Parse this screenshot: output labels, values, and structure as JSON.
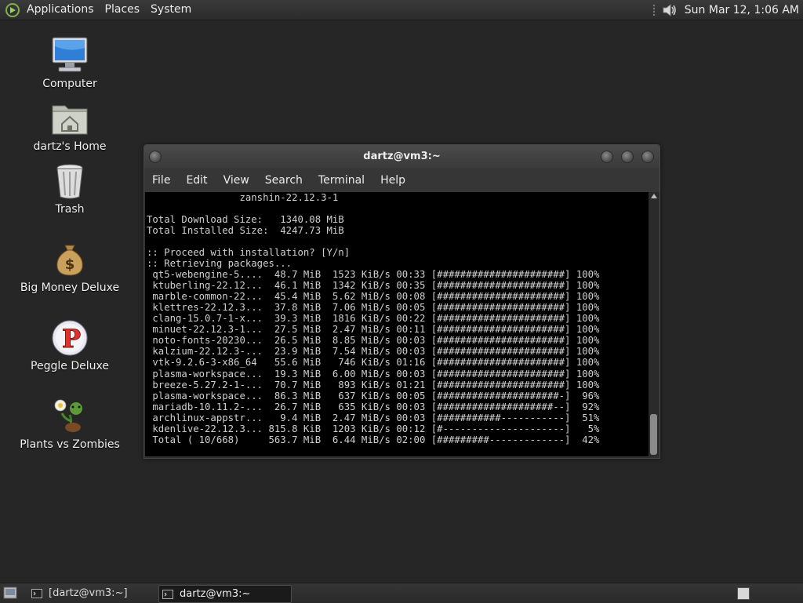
{
  "top_panel": {
    "menus": [
      "Applications",
      "Places",
      "System"
    ],
    "clock": "Sun Mar 12, 1:06 AM"
  },
  "desktop_icons": [
    {
      "name": "computer",
      "label": "Computer",
      "icon": "computer-icon"
    },
    {
      "name": "home",
      "label": "dartz's Home",
      "icon": "home-folder-icon"
    },
    {
      "name": "trash",
      "label": "Trash",
      "icon": "trash-icon"
    },
    {
      "name": "big-money",
      "label": "Big Money Deluxe",
      "icon": "money-bag-icon"
    },
    {
      "name": "peggle",
      "label": "Peggle Deluxe",
      "icon": "peggle-icon"
    },
    {
      "name": "pvz",
      "label": "Plants vs Zombies",
      "icon": "plants-icon"
    }
  ],
  "terminal": {
    "title": "dartz@vm3:~",
    "menu": [
      "File",
      "Edit",
      "View",
      "Search",
      "Terminal",
      "Help"
    ],
    "header_lines": [
      "                zanshin-22.12.3-1",
      "",
      "Total Download Size:   1340.08 MiB",
      "Total Installed Size:  4247.73 MiB",
      "",
      ":: Proceed with installation? [Y/n]",
      ":: Retrieving packages..."
    ],
    "downloads": [
      {
        "pkg": "qt5-webengine-5....",
        "size": "48.7 MiB",
        "rate": "1523 KiB/s",
        "time": "00:33",
        "bar": "[######################]",
        "pct": "100%"
      },
      {
        "pkg": "ktuberling-22.12...",
        "size": "46.1 MiB",
        "rate": "1342 KiB/s",
        "time": "00:35",
        "bar": "[######################]",
        "pct": "100%"
      },
      {
        "pkg": "marble-common-22...",
        "size": "45.4 MiB",
        "rate": "5.62 MiB/s",
        "time": "00:08",
        "bar": "[######################]",
        "pct": "100%"
      },
      {
        "pkg": "klettres-22.12.3...",
        "size": "37.8 MiB",
        "rate": "7.06 MiB/s",
        "time": "00:05",
        "bar": "[######################]",
        "pct": "100%"
      },
      {
        "pkg": "clang-15.0.7-1-x...",
        "size": "39.3 MiB",
        "rate": "1816 KiB/s",
        "time": "00:22",
        "bar": "[######################]",
        "pct": "100%"
      },
      {
        "pkg": "minuet-22.12.3-1...",
        "size": "27.5 MiB",
        "rate": "2.47 MiB/s",
        "time": "00:11",
        "bar": "[######################]",
        "pct": "100%"
      },
      {
        "pkg": "noto-fonts-20230...",
        "size": "26.5 MiB",
        "rate": "8.85 MiB/s",
        "time": "00:03",
        "bar": "[######################]",
        "pct": "100%"
      },
      {
        "pkg": "kalzium-22.12.3-...",
        "size": "23.9 MiB",
        "rate": "7.54 MiB/s",
        "time": "00:03",
        "bar": "[######################]",
        "pct": "100%"
      },
      {
        "pkg": "vtk-9.2.6-3-x86_64",
        "size": "55.6 MiB",
        "rate": " 746 KiB/s",
        "time": "01:16",
        "bar": "[######################]",
        "pct": "100%"
      },
      {
        "pkg": "plasma-workspace...",
        "size": "19.3 MiB",
        "rate": "6.00 MiB/s",
        "time": "00:03",
        "bar": "[######################]",
        "pct": "100%"
      },
      {
        "pkg": "breeze-5.27.2-1-...",
        "size": "70.7 MiB",
        "rate": " 893 KiB/s",
        "time": "01:21",
        "bar": "[######################]",
        "pct": "100%"
      },
      {
        "pkg": "plasma-workspace...",
        "size": "86.3 MiB",
        "rate": " 637 KiB/s",
        "time": "00:05",
        "bar": "[#####################-]",
        "pct": " 96%"
      },
      {
        "pkg": "mariadb-10.11.2-...",
        "size": "26.7 MiB",
        "rate": " 635 KiB/s",
        "time": "00:03",
        "bar": "[####################--]",
        "pct": " 92%"
      },
      {
        "pkg": "archlinux-appstr...",
        "size": " 9.4 MiB",
        "rate": "2.47 MiB/s",
        "time": "00:03",
        "bar": "[###########-----------]",
        "pct": " 51%"
      },
      {
        "pkg": "kdenlive-22.12.3...",
        "size": "815.8 KiB",
        "rate": "1203 KiB/s",
        "time": "00:12",
        "bar": "[#---------------------]",
        "pct": "  5%"
      },
      {
        "pkg": "Total ( 10/668)   ",
        "size": "563.7 MiB",
        "rate": "6.44 MiB/s",
        "time": "02:00",
        "bar": "[#########-------------]",
        "pct": " 42%"
      }
    ]
  },
  "taskbar": {
    "tasks": [
      {
        "label": "[dartz@vm3:~]",
        "active": false
      },
      {
        "label": "dartz@vm3:~",
        "active": true
      }
    ]
  },
  "colors": {
    "desktop_bg": "#262626",
    "panel_bg": "#2f2f2f",
    "terminal_bg": "#000000",
    "terminal_fg": "#d0d0d0"
  }
}
